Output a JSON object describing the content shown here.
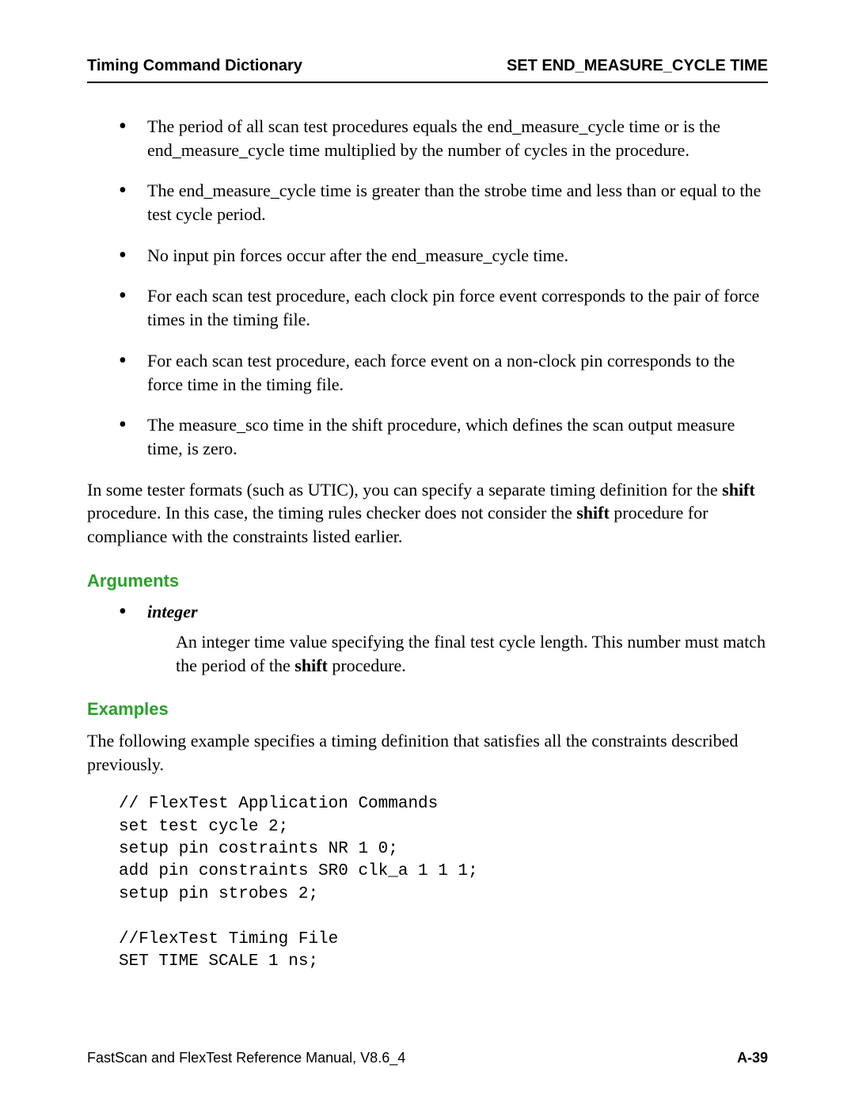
{
  "header": {
    "left": "Timing Command Dictionary",
    "right": "SET END_MEASURE_CYCLE TIME"
  },
  "bullets": [
    "The period of all scan test procedures equals the end_measure_cycle time or is the end_measure_cycle time multiplied by the number of cycles in the procedure.",
    "The end_measure_cycle time is greater than the strobe time and less than or equal to the test cycle period.",
    "No input pin forces occur after the end_measure_cycle time.",
    "For each scan test procedure, each clock pin force event corresponds to the pair of force times in the timing file.",
    "For each scan test procedure, each force event on a non-clock pin corresponds to the force time in the timing file.",
    "The measure_sco time in the shift procedure, which defines the scan output measure time, is zero."
  ],
  "after_bullets": {
    "pre1": "In some tester formats (such as UTIC), you can specify a separate timing definition for the ",
    "bold1": "shift",
    "mid1": " procedure. In this case, the timing rules checker does not consider the ",
    "bold2": "shift",
    "post1": " procedure for compliance with the constraints listed earlier."
  },
  "arguments": {
    "heading": "Arguments",
    "term": "integer",
    "desc_pre": "An integer time value specifying the final test cycle length. This number must match the period of the ",
    "desc_bold": "shift",
    "desc_post": " procedure."
  },
  "examples": {
    "heading": "Examples",
    "intro": "The following example specifies a timing definition that satisfies all the constraints described previously.",
    "code": "// FlexTest Application Commands\nset test cycle 2;\nsetup pin costraints NR 1 0;\nadd pin constraints SR0 clk_a 1 1 1;\nsetup pin strobes 2;\n\n//FlexTest Timing File\nSET TIME SCALE 1 ns;"
  },
  "footer": {
    "left": "FastScan and FlexTest Reference Manual, V8.6_4",
    "right": "A-39"
  }
}
